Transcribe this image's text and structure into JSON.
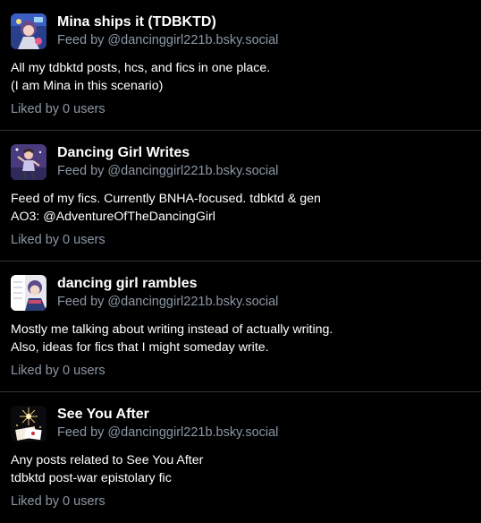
{
  "feeds": [
    {
      "title": "Mina ships it (TDBKTD)",
      "by": "Feed by @dancinggirl221b.bsky.social",
      "description": [
        "All my tdbktd posts, hcs, and fics in one place.",
        "(I am Mina in this scenario)"
      ],
      "likes": "Liked by 0 users",
      "avatar_icon": "anime-art-avatar-icon"
    },
    {
      "title": "Dancing Girl Writes",
      "by": "Feed by @dancinggirl221b.bsky.social",
      "description": [
        "Feed of my fics. Currently BNHA-focused. tdbktd & gen",
        "AO3: @AdventureOfTheDancingGirl"
      ],
      "likes": "Liked by 0 users",
      "avatar_icon": "dancing-figure-avatar-icon"
    },
    {
      "title": "dancing girl rambles",
      "by": "Feed by @dancinggirl221b.bsky.social",
      "description": [
        "Mostly me talking about writing instead of actually writing.",
        "Also, ideas for fics that I might someday write."
      ],
      "likes": "Liked by 0 users",
      "avatar_icon": "writing-character-avatar-icon"
    },
    {
      "title": "See You After",
      "by": "Feed by @dancinggirl221b.bsky.social",
      "description": [
        "Any posts related to See You After",
        "tdbktd post-war epistolary fic"
      ],
      "likes": "Liked by 0 users",
      "avatar_icon": "letter-sparkle-avatar-icon"
    }
  ],
  "colors": {
    "background": "#000000",
    "text": "#ffffff",
    "muted": "#8b98a5",
    "divider": "#2e3338"
  }
}
